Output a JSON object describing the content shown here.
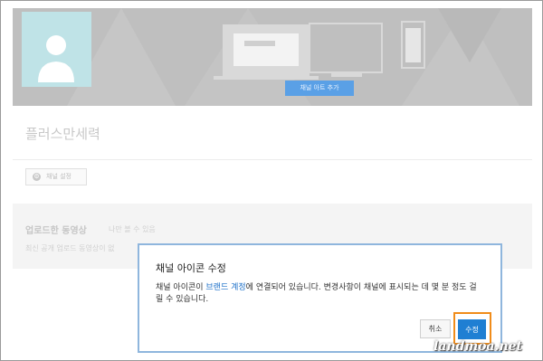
{
  "banner": {
    "add_art_label": "채널 아트 추가"
  },
  "channel": {
    "name": "플러스만세력",
    "settings_label": "채널 설정"
  },
  "uploads": {
    "title": "업로드한 동영상",
    "subtitle": "나만 볼 수 있음",
    "description": "최신 공개 업로드 동영상이 없"
  },
  "dialog": {
    "title": "채널 아이콘 수정",
    "body_prefix": "채널 아이콘이 ",
    "body_link": "브랜드 계정",
    "body_suffix": "에 연결되어 있습니다. 변경사항이 채널에 표시되는 데 몇 분 정도 걸릴 수 있습니다.",
    "cancel_label": "취소",
    "edit_label": "수정"
  },
  "watermark": "landmoa.net",
  "colors": {
    "accent": "#1f7fd3",
    "highlight": "#f08c1a",
    "link": "#1b6fc8"
  }
}
